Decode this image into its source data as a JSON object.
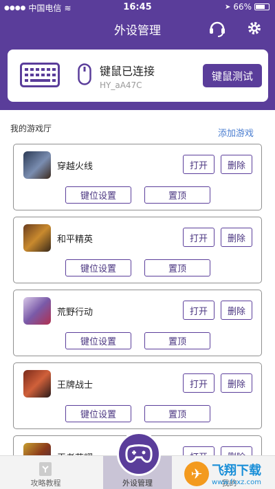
{
  "status_bar": {
    "carrier": "中国电信",
    "time": "16:45",
    "battery": "66%"
  },
  "nav": {
    "title": "外设管理"
  },
  "device": {
    "status": "键鼠已连接",
    "id": "HY_aA47C",
    "test_label": "键鼠测试"
  },
  "section": {
    "title": "我的游戏厅",
    "add_label": "添加游戏"
  },
  "games": [
    {
      "name": "穿越火线",
      "open": "打开",
      "delete": "删除",
      "keymap": "键位设置",
      "pin": "置顶"
    },
    {
      "name": "和平精英",
      "open": "打开",
      "delete": "删除",
      "keymap": "键位设置",
      "pin": "置顶"
    },
    {
      "name": "荒野行动",
      "open": "打开",
      "delete": "删除",
      "keymap": "键位设置",
      "pin": "置顶"
    },
    {
      "name": "王牌战士",
      "open": "打开",
      "delete": "删除",
      "keymap": "键位设置",
      "pin": "置顶"
    },
    {
      "name": "王者荣耀",
      "open": "打开",
      "delete": "删除"
    }
  ],
  "tabbar": {
    "left": "攻略教程",
    "mid": "外设管理",
    "right": "我的"
  },
  "watermark": {
    "title": "飞翔下载",
    "url": "www.fxxz.com"
  },
  "colors": {
    "primary": "#5a3d9a",
    "link": "#4a7dd0"
  }
}
